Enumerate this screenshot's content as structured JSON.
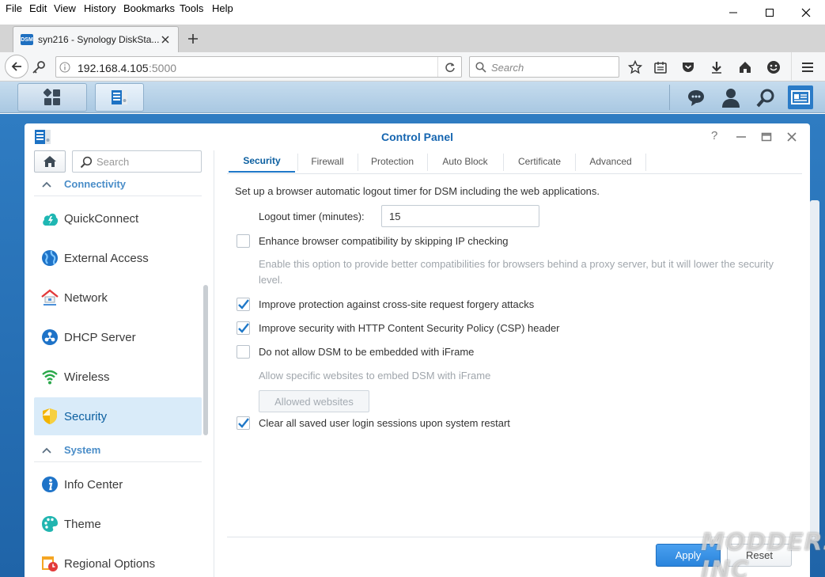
{
  "browser": {
    "menu": [
      "File",
      "Edit",
      "View",
      "History",
      "Bookmarks",
      "Tools",
      "Help"
    ],
    "tab_title": "syn216 - Synology DiskSta...",
    "tab_favicon_label": "DSM",
    "url_host": "192.168.4.105",
    "url_port": ":5000",
    "search_placeholder": "Search"
  },
  "window": {
    "title": "Control Panel",
    "help_glyph": "?"
  },
  "sidebar": {
    "search_placeholder": "Search",
    "sections": {
      "connectivity": "Connectivity",
      "system": "System"
    },
    "items": [
      {
        "label": "QuickConnect",
        "icon": "quickconnect-icon"
      },
      {
        "label": "External Access",
        "icon": "globe-icon"
      },
      {
        "label": "Network",
        "icon": "network-house-icon"
      },
      {
        "label": "DHCP Server",
        "icon": "dhcp-icon"
      },
      {
        "label": "Wireless",
        "icon": "wifi-icon"
      },
      {
        "label": "Security",
        "icon": "shield-icon"
      },
      {
        "label": "Info Center",
        "icon": "info-icon"
      },
      {
        "label": "Theme",
        "icon": "palette-icon"
      },
      {
        "label": "Regional Options",
        "icon": "calendar-clock-icon"
      }
    ],
    "active": "Security"
  },
  "tabs": [
    "Security",
    "Firewall",
    "Protection",
    "Auto Block",
    "Certificate",
    "Advanced"
  ],
  "active_tab": "Security",
  "security": {
    "intro": "Set up a browser automatic logout timer for DSM including the web applications.",
    "logout_label": "Logout timer (minutes):",
    "logout_value": "15",
    "options": [
      {
        "label": "Enhance browser compatibility by skipping IP checking",
        "checked": false
      },
      {
        "label": "Improve protection against cross-site request forgery attacks",
        "checked": true
      },
      {
        "label": "Improve security with HTTP Content Security Policy (CSP) header",
        "checked": true
      },
      {
        "label": "Do not allow DSM to be embedded with iFrame",
        "checked": false
      },
      {
        "label": "Clear all saved user login sessions upon system restart",
        "checked": true
      }
    ],
    "ip_hint": "Enable this option to provide better compatibilities for browsers behind a proxy server, but it will lower the security level.",
    "iframe_hint": "Allow specific websites to embed DSM with iFrame",
    "allowed_websites_label": "Allowed websites"
  },
  "footer": {
    "apply_label": "Apply",
    "reset_label": "Reset"
  },
  "watermark": "MODDERS INC",
  "colors": {
    "accent": "#1f78c8",
    "desktop": "#2a72b8",
    "apply_button": "#2f8ae0"
  }
}
